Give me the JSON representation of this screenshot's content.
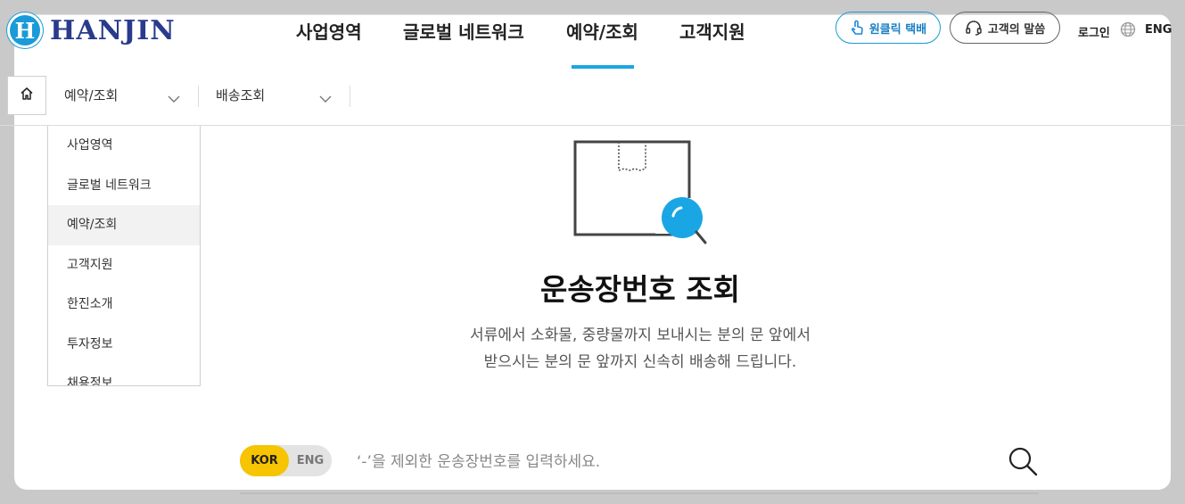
{
  "brand": {
    "logo_text": "HANJIN",
    "logo_mark": "H"
  },
  "gnb": {
    "items": [
      {
        "label": "사업영역"
      },
      {
        "label": "글로벌 네트워크"
      },
      {
        "label": "예약/조회"
      },
      {
        "label": "고객지원"
      }
    ],
    "active_index": 2
  },
  "utility": {
    "oneclick_label": "원클릭 택배",
    "voice_label": "고객의 말씀",
    "login_label": "로그인",
    "lang_label": "ENG"
  },
  "breadcrumb": {
    "level1": "예약/조회",
    "level2": "배송조회"
  },
  "dropdown": {
    "items": [
      {
        "label": "사업영역"
      },
      {
        "label": "글로벌 네트워크"
      },
      {
        "label": "예약/조회"
      },
      {
        "label": "고객지원"
      },
      {
        "label": "한진소개"
      },
      {
        "label": "투자정보"
      },
      {
        "label": "채용정보"
      }
    ],
    "active_index": 2
  },
  "hero": {
    "title": "운송장번호 조회",
    "desc_line1": "서류에서 소화물, 중량물까지 보내시는 분의 문 앞에서",
    "desc_line2": "받으시는 분의 문 앞까지 신속히 배송해 드립니다."
  },
  "search": {
    "lang_kor": "KOR",
    "lang_eng": "ENG",
    "placeholder": "‘-’을 제외한 운송장번호를 입력하세요.",
    "value": ""
  },
  "colors": {
    "accent": "#1aa6e4",
    "brand_navy": "#2a3a8c",
    "toggle_active": "#f6c400"
  },
  "icons": {
    "logo": "hanjin-logo-icon",
    "oneclick": "hand-tap-icon",
    "voice": "headset-icon",
    "lang": "globe-icon",
    "home": "home-icon",
    "chevron": "chevron-down-icon",
    "illustration": "parcel-search-icon",
    "search": "search-icon"
  }
}
